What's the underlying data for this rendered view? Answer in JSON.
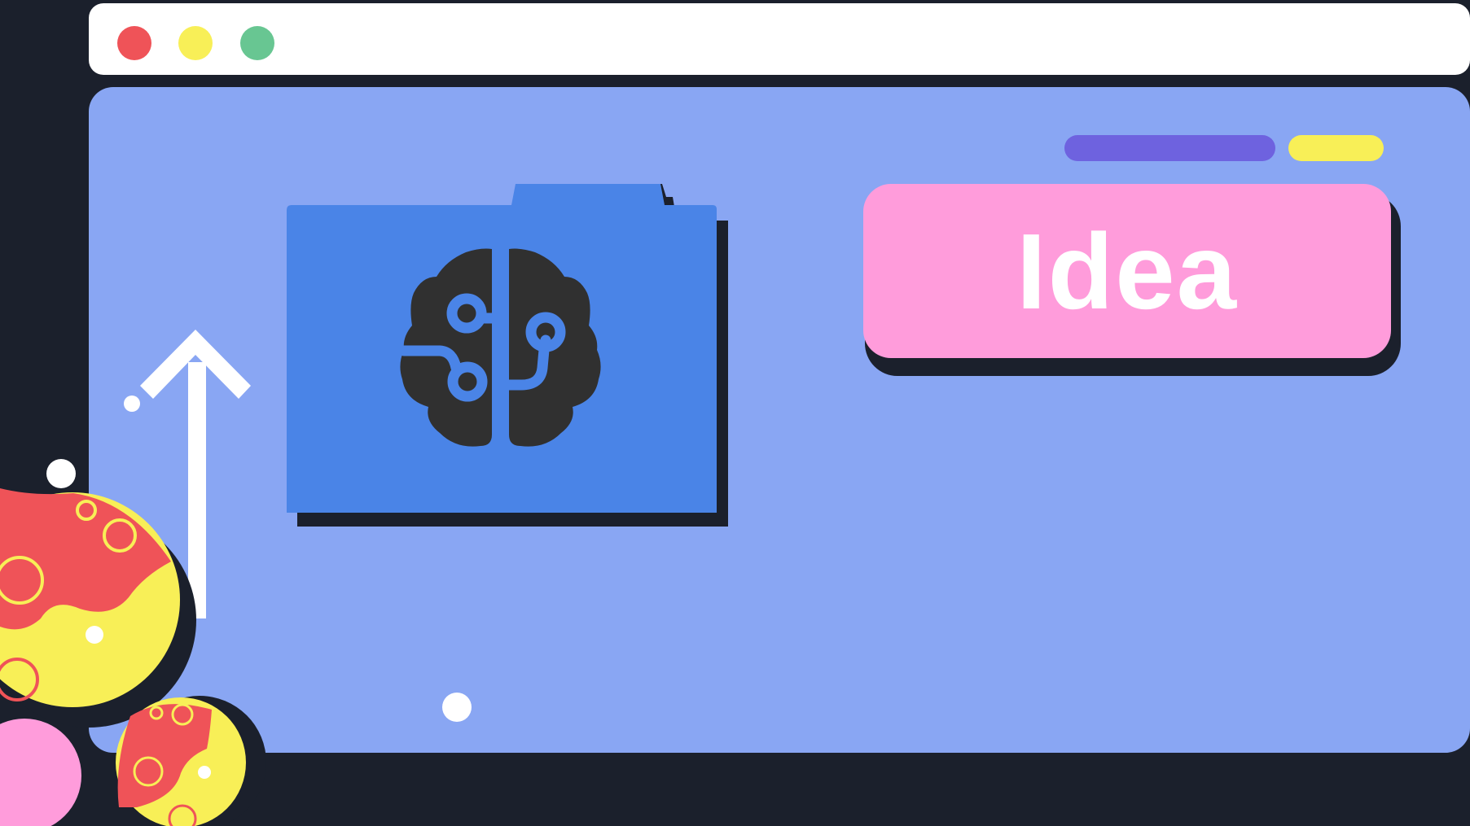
{
  "window": {
    "controls": [
      "close",
      "minimize",
      "maximize"
    ]
  },
  "card": {
    "label": "Idea"
  },
  "colors": {
    "background": "#1b202c",
    "window": "#89a6f3",
    "folder": "#4a84e7",
    "brain": "#303030",
    "card": "#ff9cdb",
    "red": "#ef5358",
    "yellow": "#f8ef57",
    "green": "#68c692",
    "purple": "#6e62df"
  },
  "icons": [
    "folder-icon",
    "brain-circuit-icon",
    "arrow-up-icon"
  ]
}
